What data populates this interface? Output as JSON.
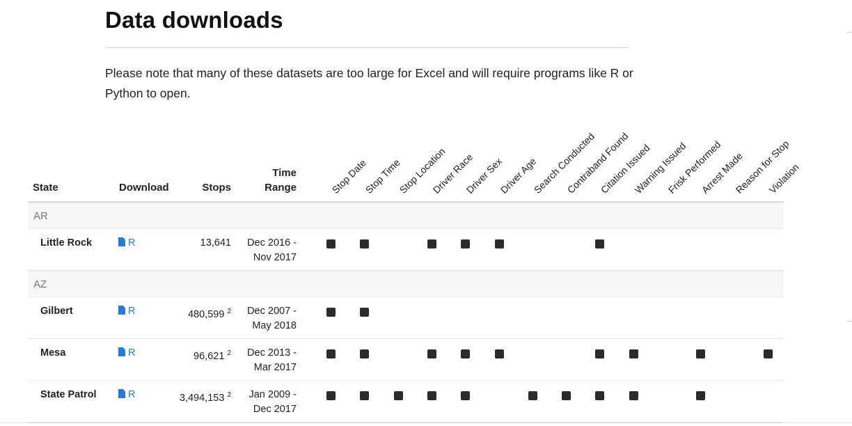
{
  "page": {
    "title": "Data downloads",
    "note": "Please note that many of these datasets are too large for Excel and will require programs like R or Python to open."
  },
  "table": {
    "headers": {
      "state": "State",
      "download": "Download",
      "stops": "Stops",
      "time_range": "Time Range"
    },
    "columns": [
      "Stop Date",
      "Stop Time",
      "Stop Location",
      "Driver Race",
      "Driver Sex",
      "Driver Age",
      "Search Conducted",
      "Contraband Found",
      "Citation Issued",
      "Warning Issued",
      "Frisk Performed",
      "Arrest Made",
      "Reason for Stop",
      "Violation"
    ],
    "groups": [
      {
        "state": "AR",
        "rows": [
          {
            "city": "Little Rock",
            "download": "R",
            "stops": "13,641",
            "footnote": "",
            "range": "Dec 2016 - Nov 2017",
            "has": [
              true,
              true,
              false,
              true,
              true,
              true,
              false,
              false,
              true,
              false,
              false,
              false,
              false,
              false
            ]
          }
        ]
      },
      {
        "state": "AZ",
        "rows": [
          {
            "city": "Gilbert",
            "download": "R",
            "stops": "480,599",
            "footnote": "2",
            "range": "Dec 2007 - May 2018",
            "has": [
              true,
              true,
              false,
              false,
              false,
              false,
              false,
              false,
              false,
              false,
              false,
              false,
              false,
              false
            ]
          },
          {
            "city": "Mesa",
            "download": "R",
            "stops": "96,621",
            "footnote": "2",
            "range": "Dec 2013 - Mar 2017",
            "has": [
              true,
              true,
              false,
              true,
              true,
              true,
              false,
              false,
              true,
              true,
              false,
              true,
              false,
              true
            ]
          },
          {
            "city": "State Patrol",
            "download": "R",
            "stops": "3,494,153",
            "footnote": "2",
            "range": "Jan 2009 - Dec 2017",
            "has": [
              true,
              true,
              true,
              true,
              true,
              false,
              true,
              true,
              true,
              true,
              false,
              true,
              false,
              false
            ]
          }
        ]
      }
    ]
  }
}
